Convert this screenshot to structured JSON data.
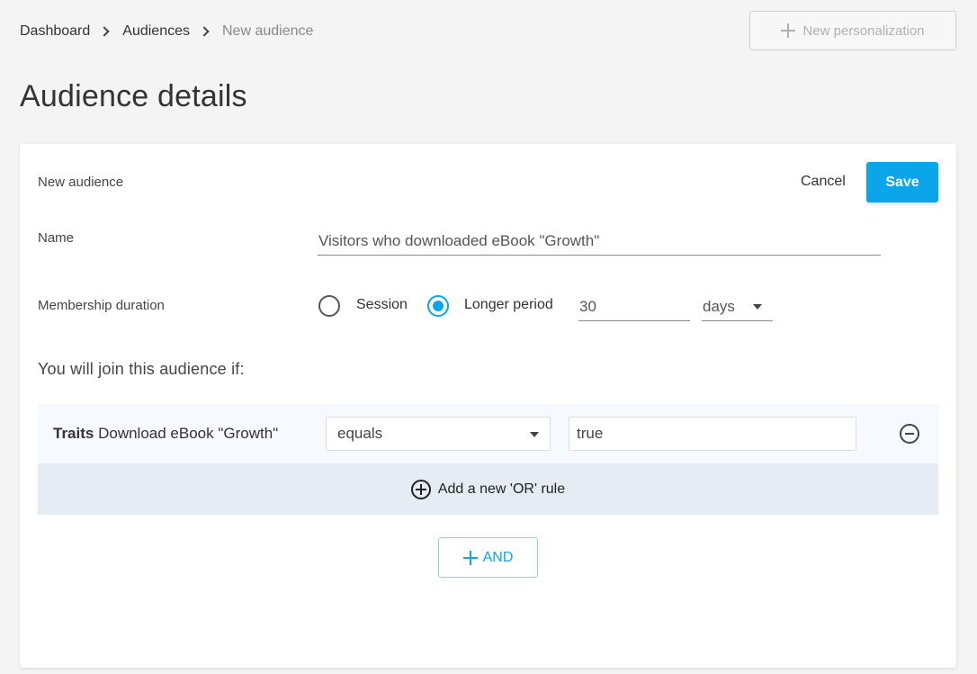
{
  "breadcrumb": {
    "items": [
      "Dashboard",
      "Audiences",
      "New audience"
    ]
  },
  "header": {
    "new_personalization_label": "New personalization",
    "title": "Audience details"
  },
  "form": {
    "header_label": "New audience",
    "cancel_label": "Cancel",
    "save_label": "Save",
    "name_label": "Name",
    "name_value": "Visitors who downloaded eBook \"Growth\"",
    "membership_label": "Membership duration",
    "membership_options": [
      {
        "label": "Session",
        "selected": false
      },
      {
        "label": "Longer period",
        "selected": true
      }
    ],
    "duration_value": "30",
    "duration_unit": "days",
    "join_text": "You will join this audience if:"
  },
  "rules": {
    "items": [
      {
        "type": "Traits",
        "name": "Download eBook \"Growth\"",
        "operator": "equals",
        "value": "true"
      }
    ],
    "add_or_label": "Add a new 'OR' rule",
    "and_label": "AND"
  },
  "colors": {
    "accent": "#0ba6ea",
    "rule_row_bg": "#f6f9fd",
    "or_row_bg": "#e5ecf4"
  }
}
